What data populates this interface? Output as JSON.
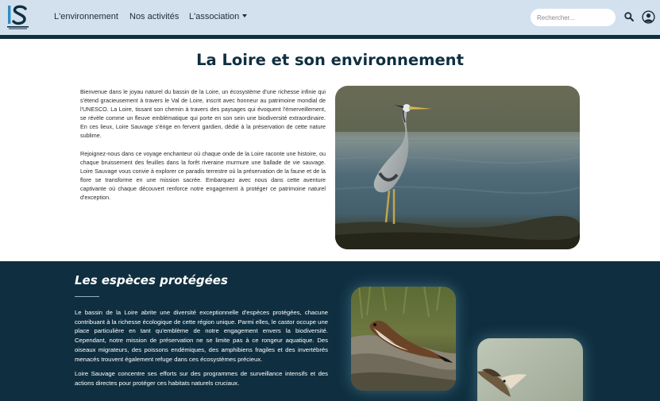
{
  "navbar": {
    "logo_icon": "loire-sauvage-logo",
    "links": [
      {
        "label": "L'environnement"
      },
      {
        "label": "Nos activités"
      },
      {
        "label": "L'association"
      }
    ],
    "search": {
      "placeholder": "Rechercher..."
    },
    "icons": {
      "search": "search-icon",
      "user": "user-icon",
      "dropdown": "caret-down-icon"
    }
  },
  "intro": {
    "title": "La Loire et son environnement",
    "paragraphs": [
      "Bienvenue dans le joyau naturel du bassin de la Loire, un écosystème d'une richesse infinie qui s'étend gracieusement à travers le Val de Loire, inscrit avec honneur au patrimoine mondial de l'UNESCO. La Loire, tissant son chemin à travers des paysages qui évoquent l'émerveillement, se révèle comme un fleuve emblématique qui porte en son sein une biodiversité extraordinaire. En ces lieux, Loire Sauvage s'érige en fervent gardien, dédié à la préservation de cette nature sublime.",
      "Rejoignez-nous dans ce voyage enchanteur où chaque onde de la Loire raconte une histoire, ou chaque bruissement des feuilles dans la forêt riveraine murmure une ballade de vie sauvage. Loire Sauvage vous convie à explorer ce paradis terrestre où la préservation de la faune et de la flore se transforme en une mission sacrée. Embarquez avec nous dans cette aventure captivante où chaque découvert renforce notre engagement à protéger ce patrimoine naturel d'exception."
    ],
    "image": "heron-photo"
  },
  "species": {
    "title": "Les espèces protégées",
    "paragraphs": [
      "Le bassin de la Loire abrite une diversité exceptionnelle d'espèces protégées, chacune contribuant à la richesse écologique de cette région unique. Parmi elles, le castor occupe une place particulière en tant qu'emblème de notre engagement envers la biodiversité. Cependant, notre mission de préservation ne se limite pas à ce rongeur aquatique. Des oiseaux migrateurs, des poissons endémiques, des amphibiens fragiles et des invertébrés menacés trouvent également refuge dans ces écosystèmes précieux.",
      "Loire Sauvage concentre ses efforts sur des programmes de surveillance intensifs et des actions directes pour protéger ces habitats naturels cruciaux."
    ],
    "images": [
      "weasel-photo",
      "bird-photo"
    ]
  },
  "colors": {
    "navbar_bg": "#d3e1ee",
    "dark_blue": "#0f2f40",
    "logo_blue": "#2a8fc4"
  }
}
